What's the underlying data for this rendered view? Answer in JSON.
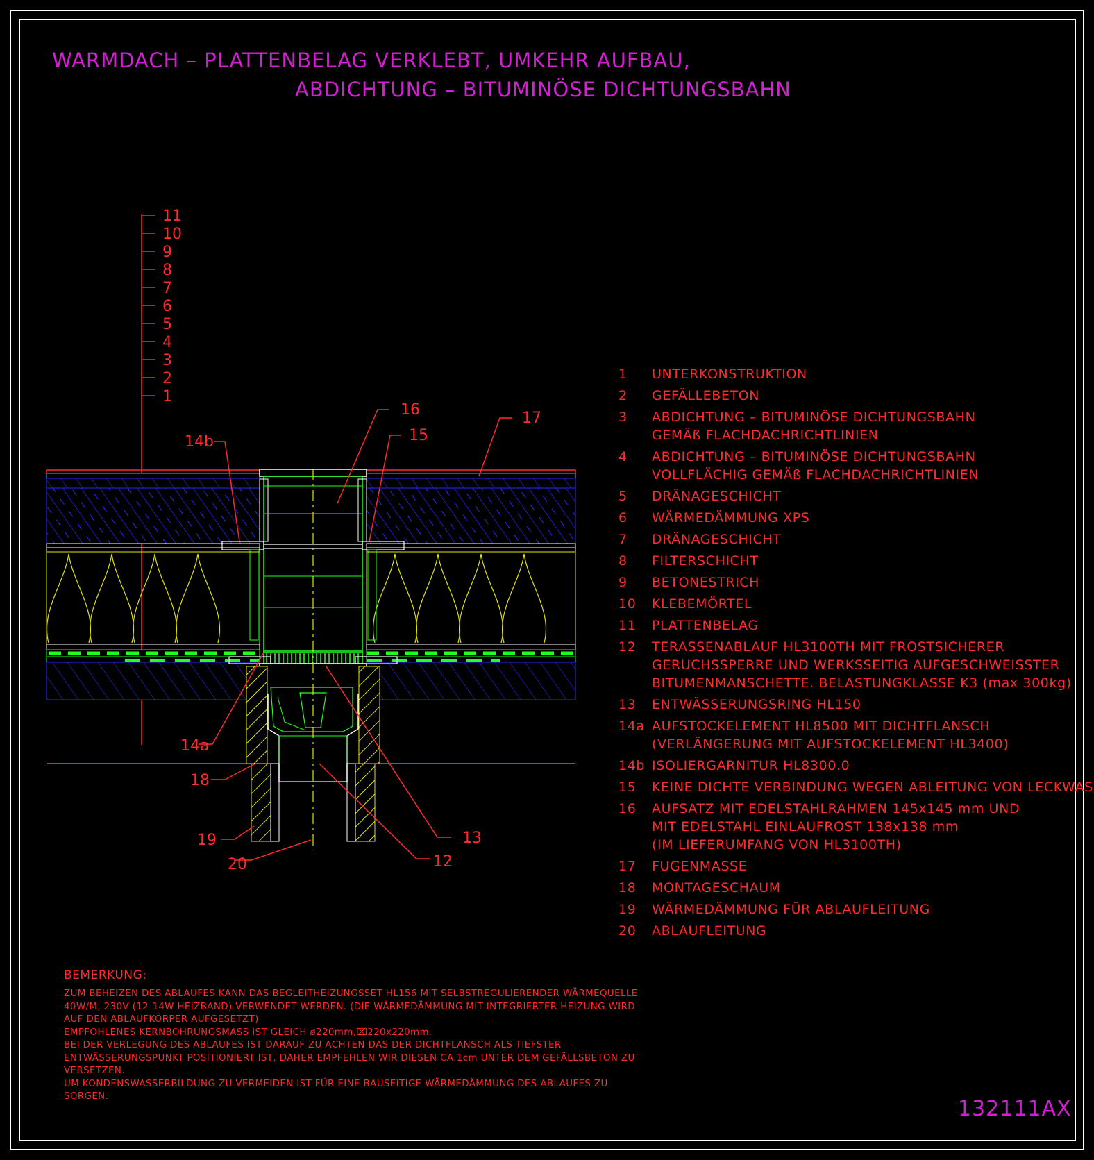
{
  "title": {
    "line1": "WARMDACH – PLATTENBELAG VERKLEBT, UMKEHR AUFBAU,",
    "line2": "ABDICHTUNG – BITUMINÖSE DICHTUNGSBAHN"
  },
  "layer_marks": [
    "11",
    "10",
    "9",
    "8",
    "7",
    "6",
    "5",
    "4",
    "3",
    "2",
    "1"
  ],
  "callouts": {
    "c14b": "14b",
    "c16": "16",
    "c15": "15",
    "c17": "17",
    "c14a": "14a",
    "c18": "18",
    "c19": "19",
    "c20": "20",
    "c12": "12",
    "c13": "13"
  },
  "legend": [
    {
      "num": "1",
      "lines": [
        "UNTERKONSTRUKTION"
      ]
    },
    {
      "num": "2",
      "lines": [
        "GEFÄLLEBETON"
      ]
    },
    {
      "num": "3",
      "lines": [
        "ABDICHTUNG – BITUMINÖSE DICHTUNGSBAHN",
        "GEMÄß FLACHDACHRICHTLINIEN"
      ]
    },
    {
      "num": "4",
      "lines": [
        "ABDICHTUNG – BITUMINÖSE DICHTUNGSBAHN",
        "VOLLFLÄCHIG GEMÄß FLACHDACHRICHTLINIEN"
      ]
    },
    {
      "num": "5",
      "lines": [
        "DRÄNAGESCHICHT"
      ]
    },
    {
      "num": "6",
      "lines": [
        "WÄRMEDÄMMUNG XPS"
      ]
    },
    {
      "num": "7",
      "lines": [
        "DRÄNAGESCHICHT"
      ]
    },
    {
      "num": "8",
      "lines": [
        "FILTERSCHICHT"
      ]
    },
    {
      "num": "9",
      "lines": [
        "BETONESTRICH"
      ]
    },
    {
      "num": "10",
      "lines": [
        "KLEBEMÖRTEL"
      ]
    },
    {
      "num": "11",
      "lines": [
        "PLATTENBELAG"
      ]
    },
    {
      "num": "12",
      "lines": [
        "TERASSENABLAUF HL3100TH MIT FROSTSICHERER",
        "GERUCHSSPERRE UND WERKSSEITIG AUFGESCHWEISSTER",
        "BITUMENMANSCHETTE. BELASTUNGKLASSE K3 (max 300kg)"
      ]
    },
    {
      "num": "13",
      "lines": [
        "ENTWÄSSERUNGSRING HL150"
      ]
    },
    {
      "num": "14a",
      "lines": [
        "AUFSTOCKELEMENT HL8500 MIT DICHTFLANSCH",
        "(VERLÄNGERUNG MIT AUFSTOCKELEMENT HL3400)"
      ]
    },
    {
      "num": "14b",
      "lines": [
        "ISOLIERGARNITUR HL8300.0"
      ]
    },
    {
      "num": "15",
      "lines": [
        "KEINE DICHTE VERBINDUNG WEGEN ABLEITUNG VON LECKWASSER"
      ]
    },
    {
      "num": "16",
      "lines": [
        "AUFSATZ MIT EDELSTAHLRAHMEN 145x145 mm UND",
        "MIT EDELSTAHL EINLAUFROST 138x138 mm",
        "(IM LIEFERUMFANG VON HL3100TH)"
      ]
    },
    {
      "num": "17",
      "lines": [
        "FUGENMASSE"
      ]
    },
    {
      "num": "18",
      "lines": [
        "MONTAGESCHAUM"
      ]
    },
    {
      "num": "19",
      "lines": [
        "WÄRMEDÄMMUNG FÜR ABLAUFLEITUNG"
      ]
    },
    {
      "num": "20",
      "lines": [
        "ABLAUFLEITUNG"
      ]
    }
  ],
  "remarks": {
    "title": "BEMERKUNG:",
    "lines": [
      "ZUM BEHEIZEN DES ABLAUFES KANN DAS BEGLEITHEIZUNGSSET HL156 MIT SELBSTREGULIERENDER WÄRMEQUELLE",
      "40W/M, 230V (12-14W HEIZBAND) VERWENDET WERDEN. (DIE WÄRMEDÄMMUNG MIT INTEGRIERTER HEIZUNG WIRD",
      "AUF DEN ABLAUFKÖRPER AUFGESETZT)",
      "EMPFOHLENES KERNBOHRUNGSMASS IST GLEICH ø220mm,⌧220x220mm.",
      "BEI DER VERLEGUNG DES ABLAUFES IST DARAUF ZU ACHTEN DAS DER DICHTFLANSCH ALS TIEFSTER",
      "ENTWÄSSERUNGSPUNKT POSITIONIERT IST, DAHER EMPFEHLEN WIR DIESEN CA.1cm UNTER DEM GEFÄLLSBETON ZU",
      "VERSETZEN.",
      "UM KONDENSWASSERBILDUNG ZU VERMEIDEN IST FÜR EINE BAUSEITIGE WÄRMEDÄMMUNG DES ABLAUFES ZU",
      "SORGEN."
    ]
  },
  "drawing_code": "132111AX",
  "colors": {
    "magenta": "#d21fd2",
    "red": "#ff2a2a",
    "blue": "#2a2aff",
    "green": "#22ff22",
    "yellow": "#e6e600",
    "white": "#ffffff",
    "cyan": "#22cccc"
  }
}
